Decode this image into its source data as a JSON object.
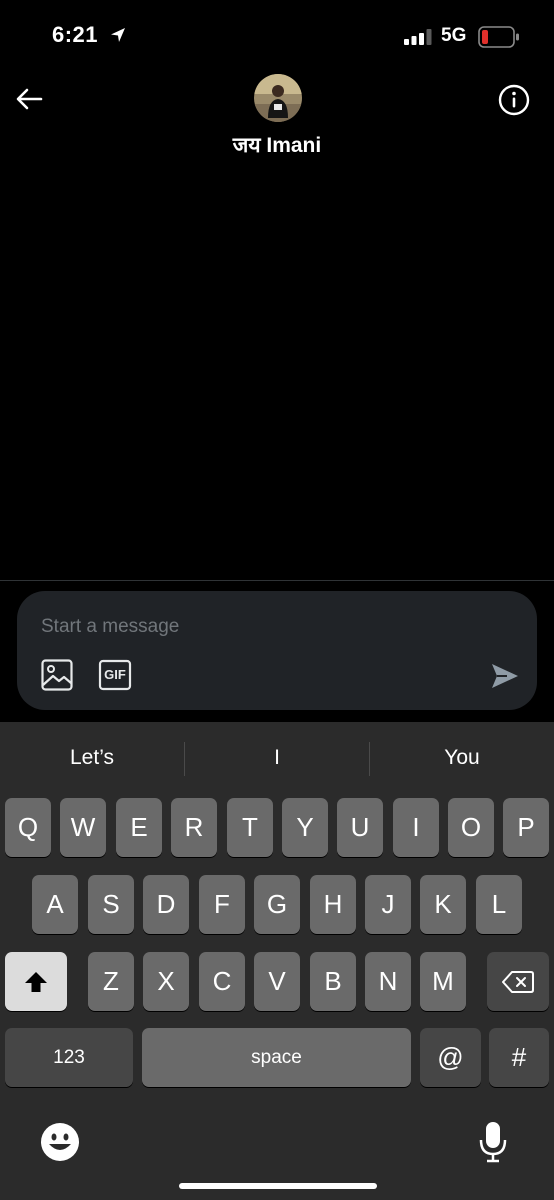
{
  "status_bar": {
    "time": "6:21",
    "network": "5G"
  },
  "header": {
    "contact_name": "जय Imani"
  },
  "composer": {
    "placeholder": "Start a message",
    "gif_label": "GIF"
  },
  "keyboard": {
    "suggestions": [
      "Let’s",
      "I",
      "You"
    ],
    "row1": [
      "Q",
      "W",
      "E",
      "R",
      "T",
      "Y",
      "U",
      "I",
      "O",
      "P"
    ],
    "row2": [
      "A",
      "S",
      "D",
      "F",
      "G",
      "H",
      "J",
      "K",
      "L"
    ],
    "row3": [
      "Z",
      "X",
      "C",
      "V",
      "B",
      "N",
      "M"
    ],
    "numbers_label": "123",
    "space_label": "space",
    "at_label": "@",
    "hash_label": "#"
  },
  "colors": {
    "background": "#000000",
    "composer_bg": "#202327",
    "placeholder": "#71767b",
    "battery_low": "#e0302b"
  }
}
